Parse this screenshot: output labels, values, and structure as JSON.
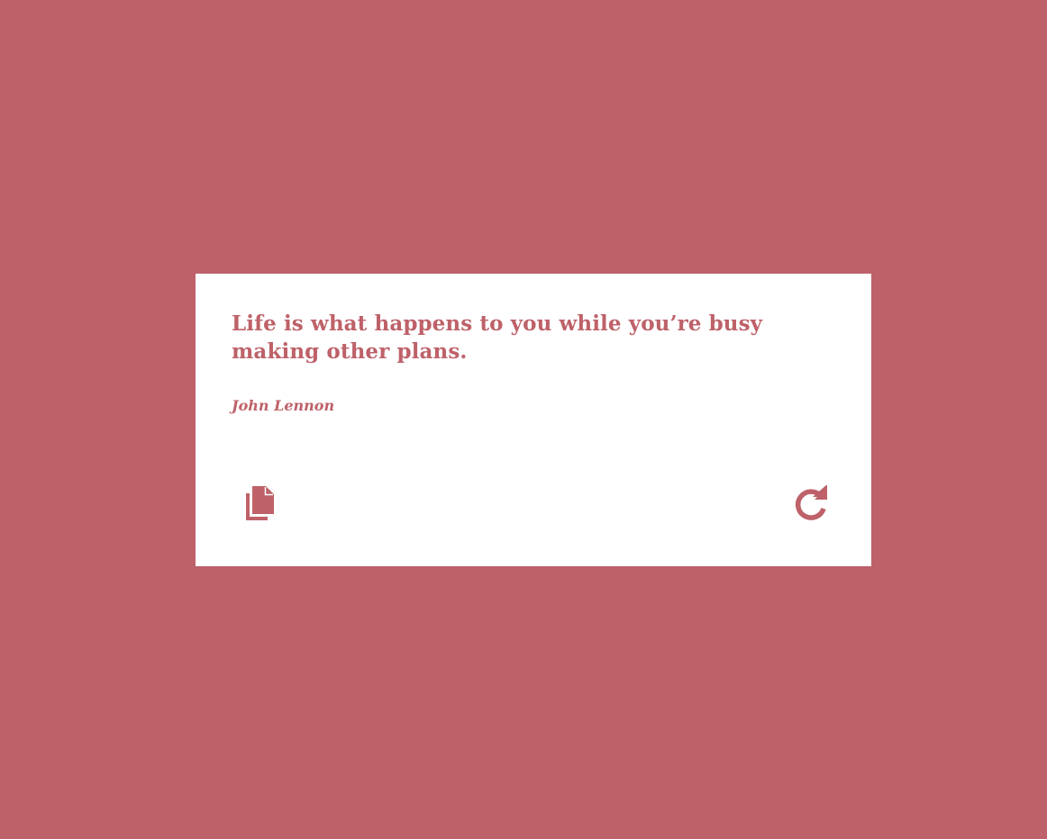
{
  "theme": {
    "background": "#BE6169",
    "card": "#FFFFFF",
    "accent": "#BE6169"
  },
  "quote": {
    "text": "Life is what happens to you while you’re busy making other plans.",
    "author": "John Lennon"
  },
  "actions": {
    "copy_icon": "copy-icon",
    "new_quote_icon": "redo-icon"
  }
}
